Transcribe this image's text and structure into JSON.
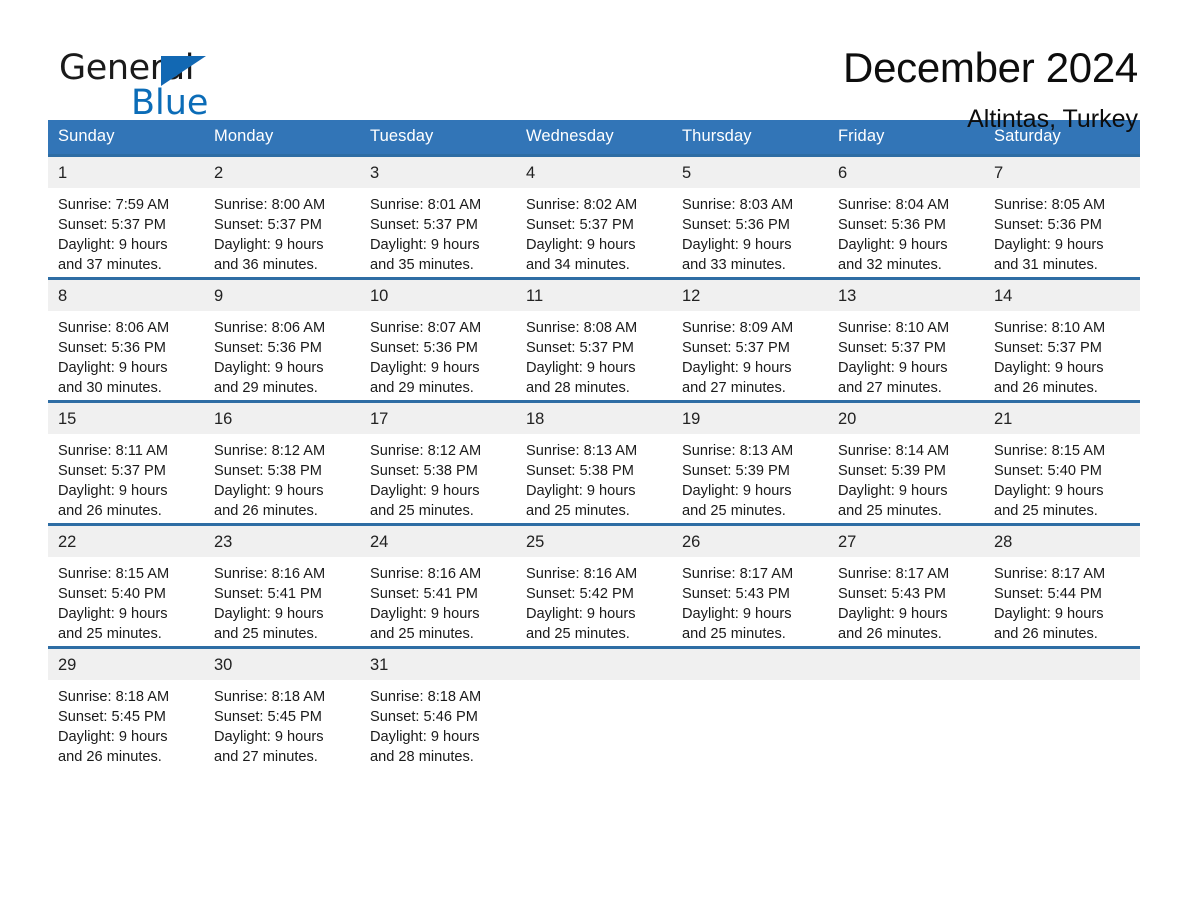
{
  "brand": {
    "name_part1": "General",
    "name_part2": "Blue",
    "accent_color": "#0b6cb7",
    "triangle_color": "#1268b3"
  },
  "header": {
    "title": "December 2024",
    "location": "Altintas, Turkey"
  },
  "calendar": {
    "header_bg": "#3275b7",
    "row_border_color": "#2e6da4",
    "daynum_bg": "#f0f0f0",
    "weekday_headers": [
      "Sunday",
      "Monday",
      "Tuesday",
      "Wednesday",
      "Thursday",
      "Friday",
      "Saturday"
    ],
    "weeks": [
      [
        {
          "day": "1",
          "sunrise": "Sunrise: 7:59 AM",
          "sunset": "Sunset: 5:37 PM",
          "daylight_line1": "Daylight: 9 hours",
          "daylight_line2": "and 37 minutes."
        },
        {
          "day": "2",
          "sunrise": "Sunrise: 8:00 AM",
          "sunset": "Sunset: 5:37 PM",
          "daylight_line1": "Daylight: 9 hours",
          "daylight_line2": "and 36 minutes."
        },
        {
          "day": "3",
          "sunrise": "Sunrise: 8:01 AM",
          "sunset": "Sunset: 5:37 PM",
          "daylight_line1": "Daylight: 9 hours",
          "daylight_line2": "and 35 minutes."
        },
        {
          "day": "4",
          "sunrise": "Sunrise: 8:02 AM",
          "sunset": "Sunset: 5:37 PM",
          "daylight_line1": "Daylight: 9 hours",
          "daylight_line2": "and 34 minutes."
        },
        {
          "day": "5",
          "sunrise": "Sunrise: 8:03 AM",
          "sunset": "Sunset: 5:36 PM",
          "daylight_line1": "Daylight: 9 hours",
          "daylight_line2": "and 33 minutes."
        },
        {
          "day": "6",
          "sunrise": "Sunrise: 8:04 AM",
          "sunset": "Sunset: 5:36 PM",
          "daylight_line1": "Daylight: 9 hours",
          "daylight_line2": "and 32 minutes."
        },
        {
          "day": "7",
          "sunrise": "Sunrise: 8:05 AM",
          "sunset": "Sunset: 5:36 PM",
          "daylight_line1": "Daylight: 9 hours",
          "daylight_line2": "and 31 minutes."
        }
      ],
      [
        {
          "day": "8",
          "sunrise": "Sunrise: 8:06 AM",
          "sunset": "Sunset: 5:36 PM",
          "daylight_line1": "Daylight: 9 hours",
          "daylight_line2": "and 30 minutes."
        },
        {
          "day": "9",
          "sunrise": "Sunrise: 8:06 AM",
          "sunset": "Sunset: 5:36 PM",
          "daylight_line1": "Daylight: 9 hours",
          "daylight_line2": "and 29 minutes."
        },
        {
          "day": "10",
          "sunrise": "Sunrise: 8:07 AM",
          "sunset": "Sunset: 5:36 PM",
          "daylight_line1": "Daylight: 9 hours",
          "daylight_line2": "and 29 minutes."
        },
        {
          "day": "11",
          "sunrise": "Sunrise: 8:08 AM",
          "sunset": "Sunset: 5:37 PM",
          "daylight_line1": "Daylight: 9 hours",
          "daylight_line2": "and 28 minutes."
        },
        {
          "day": "12",
          "sunrise": "Sunrise: 8:09 AM",
          "sunset": "Sunset: 5:37 PM",
          "daylight_line1": "Daylight: 9 hours",
          "daylight_line2": "and 27 minutes."
        },
        {
          "day": "13",
          "sunrise": "Sunrise: 8:10 AM",
          "sunset": "Sunset: 5:37 PM",
          "daylight_line1": "Daylight: 9 hours",
          "daylight_line2": "and 27 minutes."
        },
        {
          "day": "14",
          "sunrise": "Sunrise: 8:10 AM",
          "sunset": "Sunset: 5:37 PM",
          "daylight_line1": "Daylight: 9 hours",
          "daylight_line2": "and 26 minutes."
        }
      ],
      [
        {
          "day": "15",
          "sunrise": "Sunrise: 8:11 AM",
          "sunset": "Sunset: 5:37 PM",
          "daylight_line1": "Daylight: 9 hours",
          "daylight_line2": "and 26 minutes."
        },
        {
          "day": "16",
          "sunrise": "Sunrise: 8:12 AM",
          "sunset": "Sunset: 5:38 PM",
          "daylight_line1": "Daylight: 9 hours",
          "daylight_line2": "and 26 minutes."
        },
        {
          "day": "17",
          "sunrise": "Sunrise: 8:12 AM",
          "sunset": "Sunset: 5:38 PM",
          "daylight_line1": "Daylight: 9 hours",
          "daylight_line2": "and 25 minutes."
        },
        {
          "day": "18",
          "sunrise": "Sunrise: 8:13 AM",
          "sunset": "Sunset: 5:38 PM",
          "daylight_line1": "Daylight: 9 hours",
          "daylight_line2": "and 25 minutes."
        },
        {
          "day": "19",
          "sunrise": "Sunrise: 8:13 AM",
          "sunset": "Sunset: 5:39 PM",
          "daylight_line1": "Daylight: 9 hours",
          "daylight_line2": "and 25 minutes."
        },
        {
          "day": "20",
          "sunrise": "Sunrise: 8:14 AM",
          "sunset": "Sunset: 5:39 PM",
          "daylight_line1": "Daylight: 9 hours",
          "daylight_line2": "and 25 minutes."
        },
        {
          "day": "21",
          "sunrise": "Sunrise: 8:15 AM",
          "sunset": "Sunset: 5:40 PM",
          "daylight_line1": "Daylight: 9 hours",
          "daylight_line2": "and 25 minutes."
        }
      ],
      [
        {
          "day": "22",
          "sunrise": "Sunrise: 8:15 AM",
          "sunset": "Sunset: 5:40 PM",
          "daylight_line1": "Daylight: 9 hours",
          "daylight_line2": "and 25 minutes."
        },
        {
          "day": "23",
          "sunrise": "Sunrise: 8:16 AM",
          "sunset": "Sunset: 5:41 PM",
          "daylight_line1": "Daylight: 9 hours",
          "daylight_line2": "and 25 minutes."
        },
        {
          "day": "24",
          "sunrise": "Sunrise: 8:16 AM",
          "sunset": "Sunset: 5:41 PM",
          "daylight_line1": "Daylight: 9 hours",
          "daylight_line2": "and 25 minutes."
        },
        {
          "day": "25",
          "sunrise": "Sunrise: 8:16 AM",
          "sunset": "Sunset: 5:42 PM",
          "daylight_line1": "Daylight: 9 hours",
          "daylight_line2": "and 25 minutes."
        },
        {
          "day": "26",
          "sunrise": "Sunrise: 8:17 AM",
          "sunset": "Sunset: 5:43 PM",
          "daylight_line1": "Daylight: 9 hours",
          "daylight_line2": "and 25 minutes."
        },
        {
          "day": "27",
          "sunrise": "Sunrise: 8:17 AM",
          "sunset": "Sunset: 5:43 PM",
          "daylight_line1": "Daylight: 9 hours",
          "daylight_line2": "and 26 minutes."
        },
        {
          "day": "28",
          "sunrise": "Sunrise: 8:17 AM",
          "sunset": "Sunset: 5:44 PM",
          "daylight_line1": "Daylight: 9 hours",
          "daylight_line2": "and 26 minutes."
        }
      ],
      [
        {
          "day": "29",
          "sunrise": "Sunrise: 8:18 AM",
          "sunset": "Sunset: 5:45 PM",
          "daylight_line1": "Daylight: 9 hours",
          "daylight_line2": "and 26 minutes."
        },
        {
          "day": "30",
          "sunrise": "Sunrise: 8:18 AM",
          "sunset": "Sunset: 5:45 PM",
          "daylight_line1": "Daylight: 9 hours",
          "daylight_line2": "and 27 minutes."
        },
        {
          "day": "31",
          "sunrise": "Sunrise: 8:18 AM",
          "sunset": "Sunset: 5:46 PM",
          "daylight_line1": "Daylight: 9 hours",
          "daylight_line2": "and 28 minutes."
        },
        {
          "day": "",
          "sunrise": "",
          "sunset": "",
          "daylight_line1": "",
          "daylight_line2": ""
        },
        {
          "day": "",
          "sunrise": "",
          "sunset": "",
          "daylight_line1": "",
          "daylight_line2": ""
        },
        {
          "day": "",
          "sunrise": "",
          "sunset": "",
          "daylight_line1": "",
          "daylight_line2": ""
        },
        {
          "day": "",
          "sunrise": "",
          "sunset": "",
          "daylight_line1": "",
          "daylight_line2": ""
        }
      ]
    ]
  }
}
